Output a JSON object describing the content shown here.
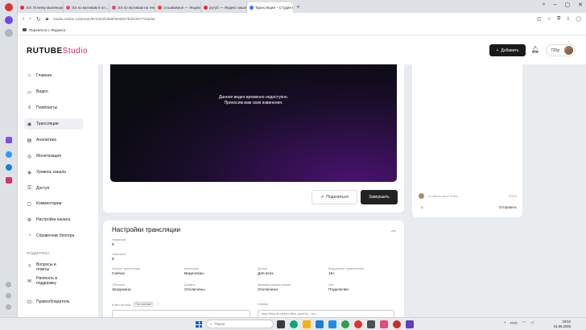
{
  "browser": {
    "tabs": [
      {
        "label": "ЭЭ: Почему маленький...",
        "color": "#e03131"
      },
      {
        "label": "ЭЭ по мотивам 5 кл...",
        "color": "#e64980"
      },
      {
        "label": "ЭЭ по мотивам на тем...",
        "color": "#e64980"
      },
      {
        "label": "отзываемое — Яндекс...",
        "color": "#f03e3e"
      },
      {
        "label": "рутуб — Яндекс нашлось",
        "color": "#e03131"
      },
      {
        "label": "Трансляция – Студия RUTUBE",
        "color": "#4c6ef5"
      }
    ],
    "new_tab": "+",
    "url": "studio.rutube.ru/stream/87e344f1d68f4e8d2e7bd1e0e7744a4a/",
    "bookmark": "Перенести с Яндекса"
  },
  "header": {
    "logo_main": "RUTUBE",
    "logo_studio": "Studio",
    "add_label": "Добавить",
    "quality": "720р"
  },
  "sidebar": {
    "items": [
      {
        "label": "Главная",
        "icon": "⌂"
      },
      {
        "label": "Видео",
        "icon": "▭"
      },
      {
        "label": "Плейлисты",
        "icon": "≡"
      },
      {
        "label": "Трансляции",
        "icon": "◉"
      },
      {
        "label": "Аналитика",
        "icon": "▤"
      },
      {
        "label": "Монетизация",
        "icon": "◎"
      },
      {
        "label": "Уровень канала",
        "icon": "◈"
      },
      {
        "label": "Доступ",
        "icon": "⚿"
      },
      {
        "label": "Комментарии",
        "icon": "▢"
      },
      {
        "label": "Настройки канала",
        "icon": "⚙"
      },
      {
        "label": "Справочник блогера",
        "icon": "◔"
      }
    ],
    "section_support": "ПОДДЕРЖКА",
    "support_items": [
      {
        "label": "Вопросы и ответы",
        "icon": "?"
      },
      {
        "label": "Написать в поддержку",
        "icon": "✉"
      },
      {
        "label": "Правообладатель",
        "icon": "⊡"
      }
    ]
  },
  "player": {
    "message_line1": "Данное видео временно недоступно.",
    "message_line2": "Приносим вам свои извинения.",
    "share_label": "Поделиться",
    "finish_label": "Завершить"
  },
  "chat": {
    "placeholder": "Оставьте свой ответ...",
    "counter": "0/300",
    "send_label": "Отправить"
  },
  "settings": {
    "title": "Настройки трансляции",
    "fields": [
      {
        "label": "Название",
        "value": "й"
      },
      {
        "label": "Описание",
        "value": "й"
      },
      {
        "label": "Начало трансляции",
        "value": "Сейчас"
      },
      {
        "label": "Категория",
        "value": "Видеоигры"
      },
      {
        "label": "Доступ",
        "value": "Для всех"
      },
      {
        "label": "Возрастное ограничение",
        "value": "18+"
      },
      {
        "label": "Обложка",
        "value": "Загружена"
      },
      {
        "label": "Донаты",
        "value": "Отключены"
      },
      {
        "label": "Автоматическая запись",
        "value": "Отключена"
      },
      {
        "label": "Чат",
        "value": "Подключён"
      }
    ],
    "key_label": "Ключ потока",
    "key_badge": "Постоянный",
    "url_label": "Сервер",
    "url_value": "rtmp://rtmp-lb.rutube.ru/live_push?s=...ey=..."
  },
  "taskbar": {
    "search_placeholder": "Поиск",
    "lang": "РУС",
    "time": "19:52",
    "date": "01.06.2026"
  }
}
